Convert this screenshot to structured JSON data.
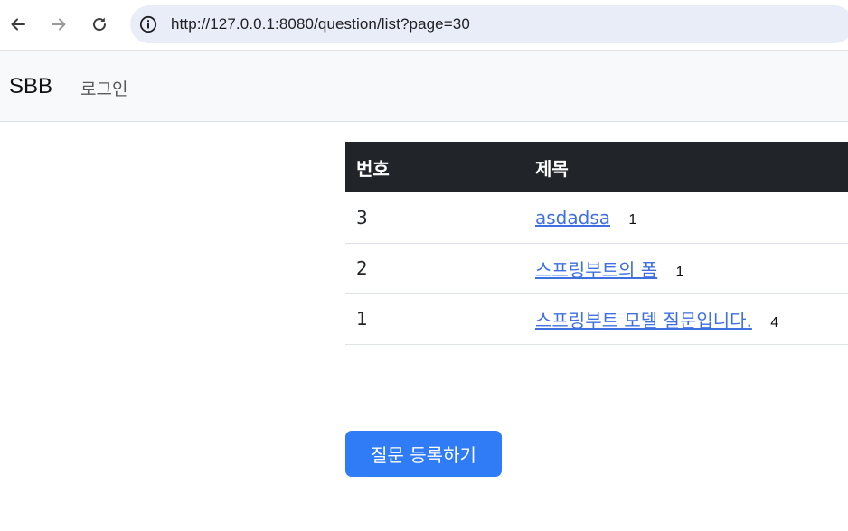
{
  "browser": {
    "url": "http://127.0.0.1:8080/question/list?page=30",
    "icons": [
      "back-arrow-icon",
      "forward-arrow-icon",
      "reload-icon",
      "info-icon"
    ]
  },
  "navbar": {
    "brand": "SBB",
    "login_label": "로그인"
  },
  "table": {
    "headers": [
      "번호",
      "제목"
    ],
    "rows": [
      {
        "num": "3",
        "title": "asdadsa",
        "answers": "1"
      },
      {
        "num": "2",
        "title": "스프링부트의 폼",
        "answers": "1"
      },
      {
        "num": "1",
        "title": "스프링부트 모델 질문입니다.",
        "answers": "4"
      }
    ]
  },
  "actions": {
    "create_label": "질문 등록하기"
  },
  "colors": {
    "header_bg": "#212529",
    "link": "#3f6fe0",
    "primary_button": "#2f7cf6",
    "navbar_bg": "#f8f9fa",
    "omnibox_bg": "#e9edf7"
  }
}
